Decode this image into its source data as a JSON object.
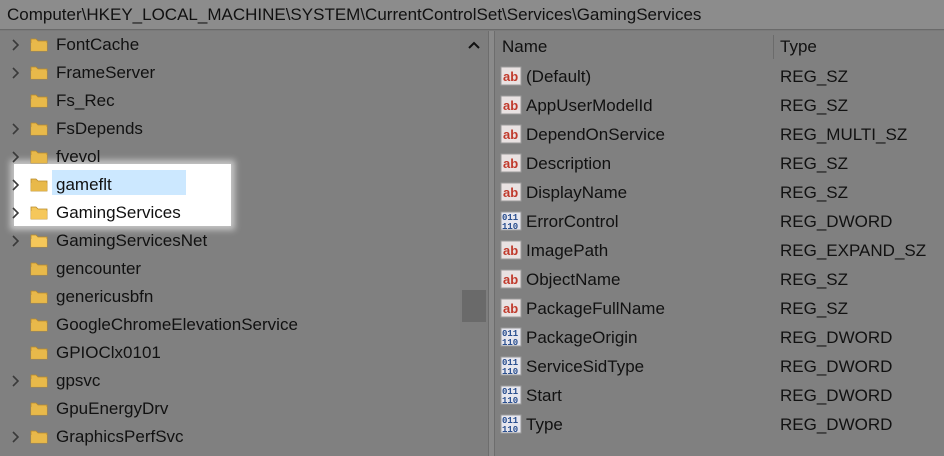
{
  "address_bar": {
    "path": "Computer\\HKEY_LOCAL_MACHINE\\SYSTEM\\CurrentControlSet\\Services\\GamingServices"
  },
  "tree": {
    "items": [
      {
        "label": "FontCache",
        "expandable": true,
        "highlighted": false,
        "selected": false
      },
      {
        "label": "FrameServer",
        "expandable": true,
        "highlighted": false,
        "selected": false
      },
      {
        "label": "Fs_Rec",
        "expandable": false,
        "highlighted": false,
        "selected": false
      },
      {
        "label": "FsDepends",
        "expandable": true,
        "highlighted": false,
        "selected": false
      },
      {
        "label": "fvevol",
        "expandable": true,
        "highlighted": false,
        "selected": false
      },
      {
        "label": "gameflt",
        "expandable": true,
        "highlighted": false,
        "selected": false
      },
      {
        "label": "GamingServices",
        "expandable": true,
        "highlighted": true,
        "selected": true
      },
      {
        "label": "GamingServicesNet",
        "expandable": true,
        "highlighted": true,
        "selected": false
      },
      {
        "label": "gencounter",
        "expandable": false,
        "highlighted": false,
        "selected": false
      },
      {
        "label": "genericusbfn",
        "expandable": false,
        "highlighted": false,
        "selected": false
      },
      {
        "label": "GoogleChromeElevationService",
        "expandable": false,
        "highlighted": false,
        "selected": false
      },
      {
        "label": "GPIOClx0101",
        "expandable": false,
        "highlighted": false,
        "selected": false
      },
      {
        "label": "gpsvc",
        "expandable": true,
        "highlighted": false,
        "selected": false
      },
      {
        "label": "GpuEnergyDrv",
        "expandable": false,
        "highlighted": false,
        "selected": false
      },
      {
        "label": "GraphicsPerfSvc",
        "expandable": true,
        "highlighted": false,
        "selected": false
      }
    ]
  },
  "values_pane": {
    "columns": {
      "name": "Name",
      "type": "Type"
    },
    "rows": [
      {
        "name": "(Default)",
        "type": "REG_SZ",
        "icon": "string-value-icon"
      },
      {
        "name": "AppUserModelId",
        "type": "REG_SZ",
        "icon": "string-value-icon"
      },
      {
        "name": "DependOnService",
        "type": "REG_MULTI_SZ",
        "icon": "string-value-icon"
      },
      {
        "name": "Description",
        "type": "REG_SZ",
        "icon": "string-value-icon"
      },
      {
        "name": "DisplayName",
        "type": "REG_SZ",
        "icon": "string-value-icon"
      },
      {
        "name": "ErrorControl",
        "type": "REG_DWORD",
        "icon": "binary-value-icon"
      },
      {
        "name": "ImagePath",
        "type": "REG_EXPAND_SZ",
        "icon": "string-value-icon"
      },
      {
        "name": "ObjectName",
        "type": "REG_SZ",
        "icon": "string-value-icon"
      },
      {
        "name": "PackageFullName",
        "type": "REG_SZ",
        "icon": "string-value-icon"
      },
      {
        "name": "PackageOrigin",
        "type": "REG_DWORD",
        "icon": "binary-value-icon"
      },
      {
        "name": "ServiceSidType",
        "type": "REG_DWORD",
        "icon": "binary-value-icon"
      },
      {
        "name": "Start",
        "type": "REG_DWORD",
        "icon": "binary-value-icon"
      },
      {
        "name": "Type",
        "type": "REG_DWORD",
        "icon": "binary-value-icon"
      }
    ]
  },
  "colors": {
    "highlight_box": "#ffffff",
    "selection": "#cce8ff",
    "folder": "#e8b84a",
    "string_icon": "#c0392b",
    "binary_icon": "#2a4f8f"
  }
}
